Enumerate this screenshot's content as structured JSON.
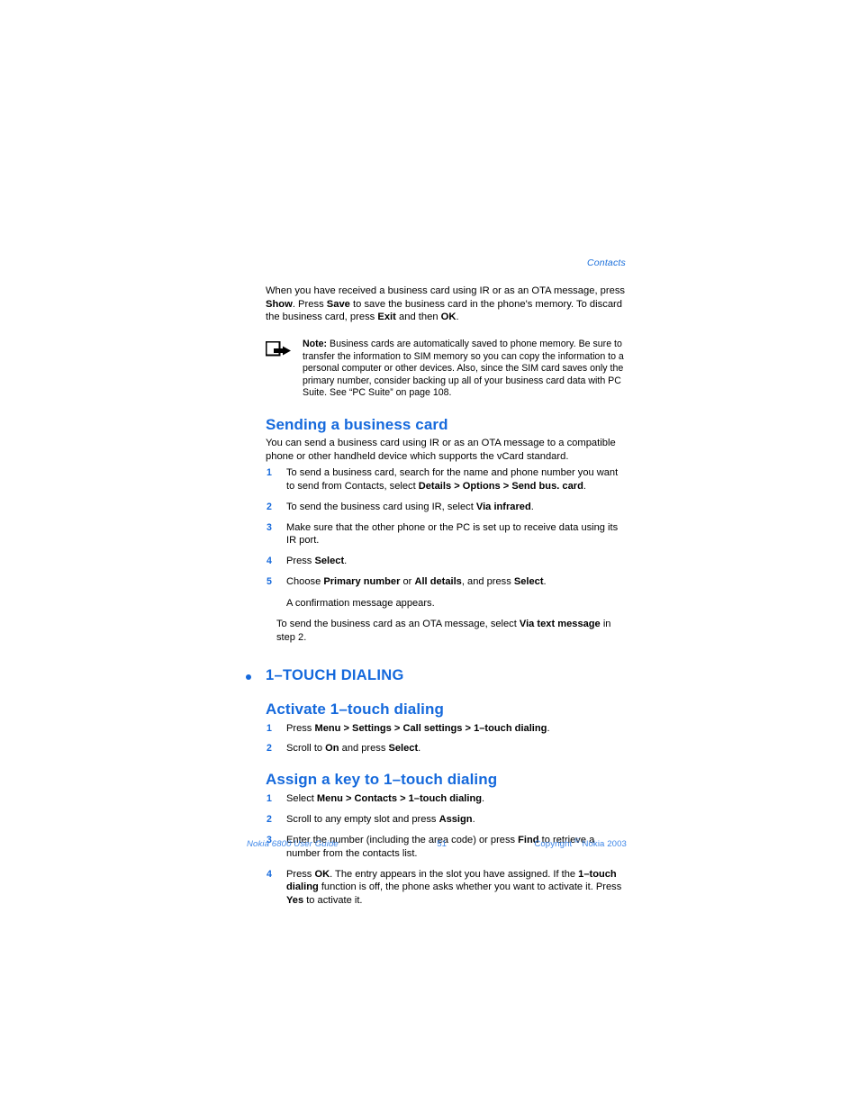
{
  "page": {
    "running_head": "Contacts",
    "number": "51"
  },
  "intro": {
    "line1_a": "When you have received a business card using IR or as an OTA message, press ",
    "line1_b": "Show",
    "line1_c": ". Press ",
    "line1_d": "Save",
    "line1_e": " to save the business card in the phone's memory. To discard the business card, press ",
    "line1_f": "Exit",
    "line1_g": " and then ",
    "line1_h": "OK",
    "line1_i": "."
  },
  "note": {
    "icon": "note-arrow-icon",
    "label": "Note:",
    "text": " Business cards are automatically saved to phone memory. Be sure to transfer the information to SIM memory so you can copy the information to a personal computer or other devices. Also, since the SIM card saves only the primary number, consider backing up all of your business card data with PC Suite. See “PC Suite” on page 108."
  },
  "sending": {
    "heading": "Sending a business card",
    "intro": "You can send a business card using IR or as an OTA message to a compatible phone or other handheld device which supports the vCard standard.",
    "steps": [
      {
        "num": "1",
        "a": "To send a business card, search for the name and phone number you want to send from Contacts, select ",
        "b": "Details > Options > Send bus. card",
        "c": "."
      },
      {
        "num": "2",
        "a": "To send the business card using IR, select ",
        "b": "Via infrared",
        "c": "."
      },
      {
        "num": "3",
        "a": "Make sure that the other phone or the PC is set up to receive data using its IR port.",
        "b": "",
        "c": ""
      },
      {
        "num": "4",
        "a": "Press ",
        "b": "Select",
        "c": "."
      },
      {
        "num": "5",
        "a": "Choose ",
        "b": "Primary number",
        "c": " or ",
        "d": "All details",
        "e": ", and press ",
        "f": "Select",
        "g": "."
      }
    ],
    "confirmation": "A confirmation message appears.",
    "ota_a": "To send the business card as an OTA message, select ",
    "ota_b": "Via text message",
    "ota_c": " in step 2."
  },
  "one_touch": {
    "section_title": "1–TOUCH DIALING",
    "activate": {
      "heading": "Activate 1–touch dialing",
      "steps": [
        {
          "num": "1",
          "a": "Press ",
          "b": "Menu > Settings > Call settings > 1–touch dialing",
          "c": "."
        },
        {
          "num": "2",
          "a": "Scroll to ",
          "b": "On",
          "c": " and press ",
          "d": "Select",
          "e": "."
        }
      ]
    },
    "assign": {
      "heading": "Assign a key to 1–touch dialing",
      "steps": [
        {
          "num": "1",
          "a": "Select ",
          "b": "Menu > Contacts > 1–touch dialing",
          "c": "."
        },
        {
          "num": "2",
          "a": "Scroll to any empty slot and press ",
          "b": "Assign",
          "c": "."
        },
        {
          "num": "3",
          "a": "Enter the number (including the area code) or press ",
          "b": "Find",
          "c": " to retrieve a number from the contacts list."
        },
        {
          "num": "4",
          "a": "Press ",
          "b": "OK",
          "c": ". The entry appears in the slot you have assigned. If the ",
          "d": "1–touch dialing",
          "e": " function is off, the phone asks whether you want to activate it. Press ",
          "f": "Yes",
          "g": " to activate it."
        }
      ]
    }
  },
  "footer": {
    "left": "Nokia 6800 User Guide",
    "center": "51",
    "copyright_pre": "Copyright ",
    "copyright_sym": "©",
    "copyright_post": " Nokia 2003"
  },
  "colors": {
    "accent_blue": "#1569dc",
    "footer_blue": "#3d86e8",
    "text_black": "#000000",
    "background": "#ffffff"
  }
}
